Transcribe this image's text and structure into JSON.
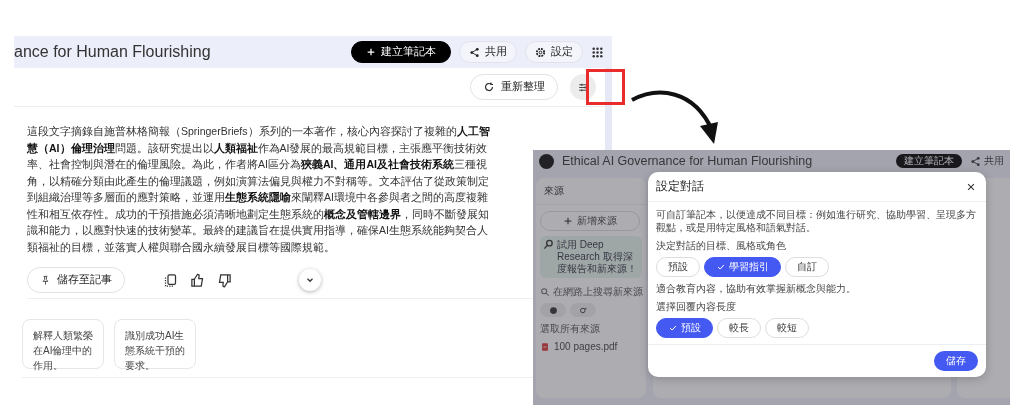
{
  "left_screen": {
    "title": "ance for Human Flourishing",
    "header_buttons": [
      {
        "label": "建立筆記本",
        "kind": "create"
      },
      {
        "label": "共用",
        "kind": "share"
      },
      {
        "label": "設定",
        "kind": "settings"
      }
    ],
    "refresh_button": "重新整理",
    "summary": "這段文字摘錄自施普林格簡報（SpringerBriefs）系列的一本著作，核心內容探討了複雜的**人工智慧（AI）倫理治理**問題。該研究提出以**人類福祉**作為AI發展的最高規範目標，主張應平衡技術效率、社會控制與潛在的倫理風險。為此，作者將AI區分為**狹義AI、通用AI及社會技術系統**三種視角，以精確分類由此產生的倫理議題，例如演算法偏見與權力不對稱等。文本評估了從政策制定到組織治理等多層面的應對策略，並運用**生態系統隱喻**來闡釋AI環境中各參與者之間的高度複雜性和相互依存性。成功的干預措施必須清晰地劃定生態系統的**概念及管轄邊界**，同時不斷發展知識和能力，以應對快速的技術變革。最終的建議旨在提供實用指導，確保AI生態系統能夠契合人類福祉的目標，並落實人權與聯合國永續發展目標等國際規範。",
    "save_note_button": "儲存至記事",
    "suggestions": [
      "解釋人類繁榮在AI倫理中的作用。",
      "識別成功AI生態系統干預的要求。"
    ]
  },
  "right_screen": {
    "title": "Ethical AI Governance for Human Flourishing",
    "create_button": "建立筆記本",
    "share_button": "共用",
    "sources": {
      "heading": "來源",
      "add_button": "新增來源",
      "deep_research": "試用 Deep Research 取得深度報告和新來源！",
      "search_placeholder": "在網路上搜尋新來源",
      "select_all": "選取所有來源",
      "files": [
        "100 pages.pdf"
      ]
    },
    "dialog": {
      "title": "設定對話",
      "description": "可自訂筆記本，以便達成不同目標：例如進行研究、協助學習、呈現多方觀點，或是用特定風格和語氣對話。",
      "goal_label": "決定對話的目標、風格或角色",
      "goal_options": [
        {
          "label": "預設",
          "selected": false
        },
        {
          "label": "學習指引",
          "selected": true
        },
        {
          "label": "自訂",
          "selected": false
        }
      ],
      "goal_hint": "適合教育內容，協助有效掌握新概念與能力。",
      "length_label": "選擇回覆內容長度",
      "length_options": [
        {
          "label": "預設",
          "selected": true
        },
        {
          "label": "較長",
          "selected": false
        },
        {
          "label": "較短",
          "selected": false
        }
      ],
      "save_button": "儲存"
    }
  }
}
